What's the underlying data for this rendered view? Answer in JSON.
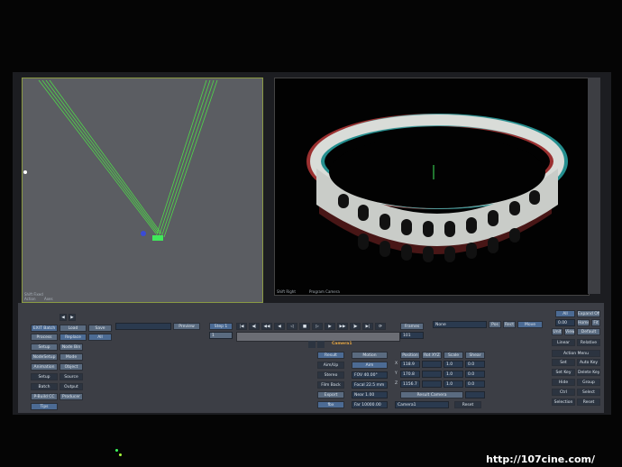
{
  "viewports": {
    "left_caption_a": "Shift Fixed",
    "left_caption_b": "Action",
    "left_caption_c": "Axes",
    "right_caption_a": "Shift Right",
    "right_caption_b": "Program Camera"
  },
  "sidebar_left": {
    "batch": "EXIT Batch",
    "process": "Process",
    "setup": "Setup",
    "node_setup": "NodeSetup",
    "animation": "Animation",
    "setup2": "Setup",
    "batch2": "Batch",
    "prebuild": "P-Build CC",
    "tips": "Tips",
    "load": "Load",
    "save": "Save",
    "replace": "Replace",
    "all": "All",
    "node_bin": "Node Bin",
    "mode": "Mode",
    "object": "Object",
    "source": "Source",
    "output": "Output",
    "producer": "Producer"
  },
  "transport": {
    "step": "Step 1",
    "frames": "Frames",
    "frame_value": "1",
    "end_value": "101",
    "preview": "Preview"
  },
  "camera_panel": {
    "title": "Camera1",
    "result": "Result",
    "aim_up": "Aim/Up",
    "stereo": "Stereo",
    "film_back": "Film Back",
    "export": "Export",
    "fbx": "fbx",
    "motion": "Motion",
    "aim": "Aim",
    "fov": "FOV 40.00°",
    "focal": "Focal 22.5 mm",
    "near": "Near 1.00",
    "far": "Far 10000.00",
    "position": "Position",
    "rot_xyz": "Rot XYZ",
    "scale": "Scale",
    "shear": "Shear",
    "x_pos": "118.9",
    "y_pos": "170.8",
    "z_pos": "1156.7",
    "x_scale": "1.0",
    "y_scale": "1.0",
    "z_scale": "1.0",
    "x_shear": "0.0",
    "y_shear": "0.0",
    "z_shear": "0.0",
    "x_label": "X",
    "y_label": "Y",
    "z_label": "Z",
    "result_camera": "Result Camera",
    "camera_dropdown": "Camera1",
    "reset": "Reset"
  },
  "right_panel": {
    "none": "None",
    "pos": "Pos",
    "rect": "Rect",
    "move": "Move",
    "all": "All",
    "expand": "Expand Off",
    "val1": "0.00",
    "home": "Home",
    "fit": "Fit",
    "unit": "Unit",
    "view": "View",
    "default": "Default",
    "linear": "Linear",
    "relative": "Relative",
    "action_menu": "Action Menu",
    "set": "Set",
    "auto_key": "Auto Key",
    "set_key": "Set Key",
    "delete_key": "Delete Key",
    "hide": "Hide",
    "group": "Group",
    "ctrl": "Ctrl",
    "select": "Select",
    "selection": "Selection",
    "reset": "Reset"
  },
  "watermark": "http://107cine.com/"
}
